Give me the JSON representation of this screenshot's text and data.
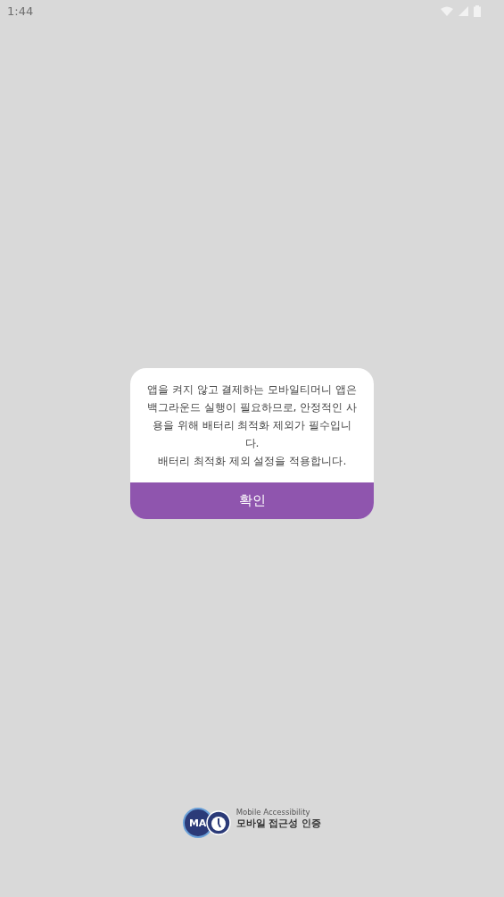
{
  "status_bar": {
    "time": "1:44"
  },
  "dialog": {
    "paragraphs": [
      "앱을 켜지 않고 결제하는 모바일티머니 앱은 백그라운드 실행이 필요하므로, 안정적인 사용을 위해 배터리 최적화 제외가 필수입니다.",
      "배터리 최적화 제외 설정을 적용합니다."
    ],
    "button": "확인"
  },
  "badge": {
    "logo_text": "MA",
    "title": "Mobile Accessibility",
    "subtitle": "모바일 접근성 인증"
  }
}
